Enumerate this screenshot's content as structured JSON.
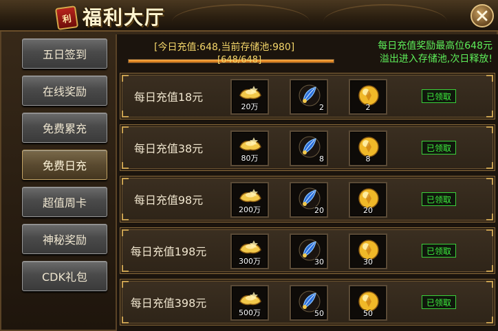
{
  "header": {
    "title": "福利大厅",
    "seal_text": "利"
  },
  "sidebar": {
    "items": [
      {
        "label": "五日签到"
      },
      {
        "label": "在线奖励"
      },
      {
        "label": "免费累充"
      },
      {
        "label": "免费日充",
        "active": true
      },
      {
        "label": "超值周卡"
      },
      {
        "label": "神秘奖励"
      },
      {
        "label": "CDK礼包"
      }
    ]
  },
  "info": {
    "today_text": "[今日充值:648,当前存储池:980]",
    "progress_label": "[648/648]",
    "progress_fraction": 1.0,
    "note_line1": "每日充值奖励最高位648元",
    "note_line2": "溢出进入存储池,次日释放!"
  },
  "rows": [
    {
      "label": "每日充值18元",
      "items": [
        {
          "icon": "gold-ingot-icon",
          "count": "20万"
        },
        {
          "icon": "blue-feather-icon",
          "count": "2"
        },
        {
          "icon": "gold-orb-icon",
          "count": "2"
        }
      ],
      "status": "已领取"
    },
    {
      "label": "每日充值38元",
      "items": [
        {
          "icon": "gold-ingot-icon",
          "count": "80万"
        },
        {
          "icon": "blue-feather-icon",
          "count": "8"
        },
        {
          "icon": "gold-orb-icon",
          "count": "8"
        }
      ],
      "status": "已领取"
    },
    {
      "label": "每日充值98元",
      "items": [
        {
          "icon": "gold-ingot-icon",
          "count": "200万"
        },
        {
          "icon": "blue-feather-icon",
          "count": "20"
        },
        {
          "icon": "gold-orb-icon",
          "count": "20"
        }
      ],
      "status": "已领取"
    },
    {
      "label": "每日充值198元",
      "items": [
        {
          "icon": "gold-ingot-icon",
          "count": "300万"
        },
        {
          "icon": "blue-feather-icon",
          "count": "30"
        },
        {
          "icon": "gold-orb-icon",
          "count": "30"
        }
      ],
      "status": "已领取"
    },
    {
      "label": "每日充值398元",
      "items": [
        {
          "icon": "gold-ingot-icon",
          "count": "500万"
        },
        {
          "icon": "blue-feather-icon",
          "count": "50"
        },
        {
          "icon": "gold-orb-icon",
          "count": "50"
        }
      ],
      "status": "已领取"
    }
  ],
  "colors": {
    "accent_gold": "#f4d66a",
    "note_green": "#5ef05a",
    "claimed_green": "#3ef03e"
  }
}
